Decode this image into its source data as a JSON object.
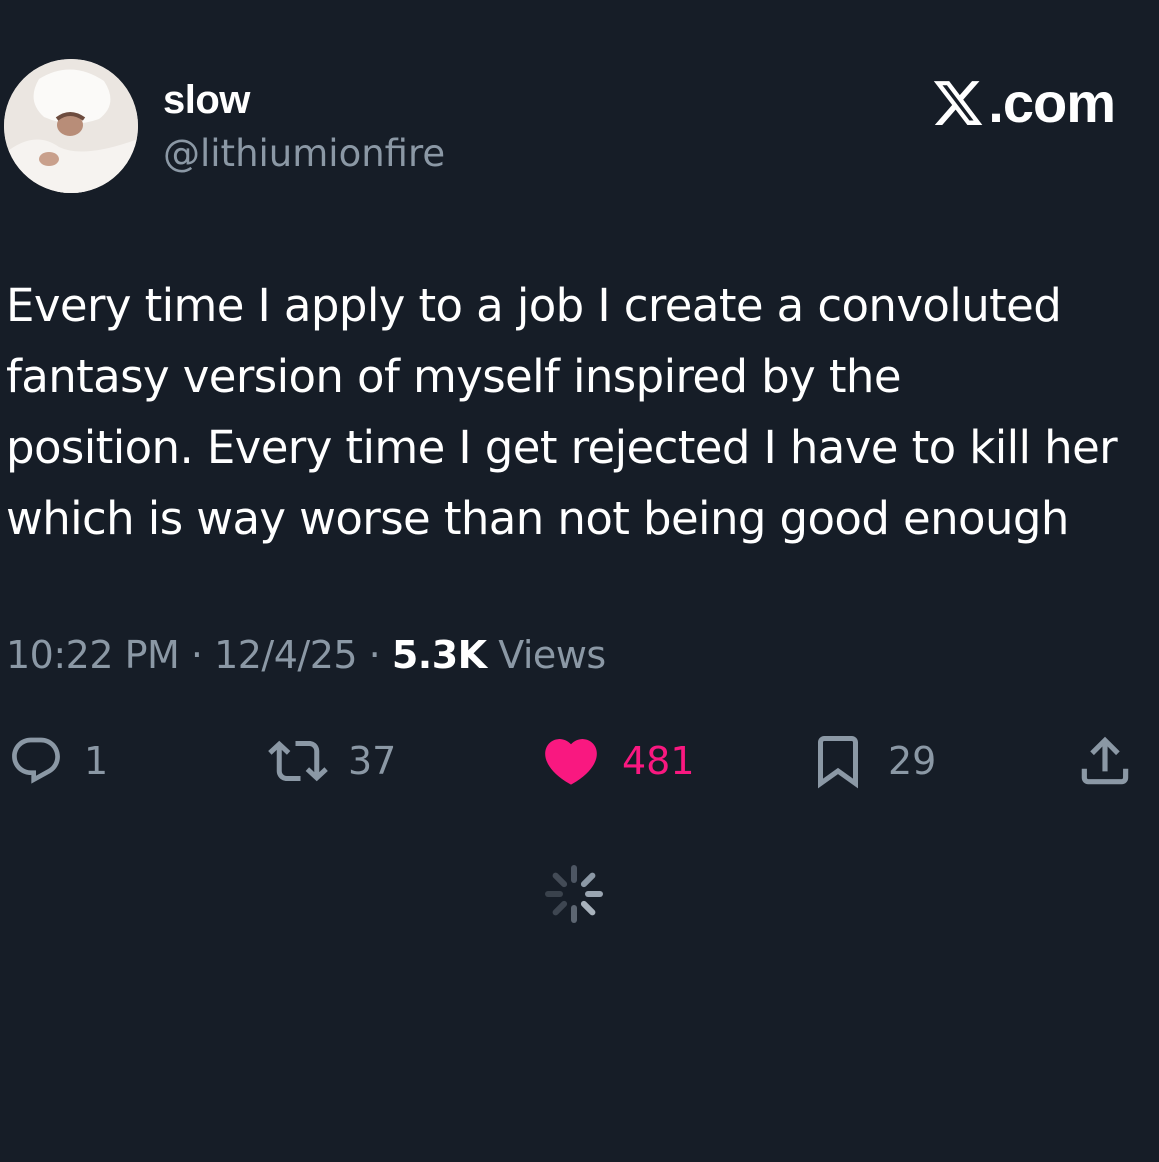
{
  "author": {
    "display_name": "slow",
    "handle": "@lithiumionfire"
  },
  "brand": {
    "label": ".com",
    "icon": "x-logo-icon"
  },
  "tweet": {
    "lines": [
      "Every time I apply to a job I create a convoluted",
      "fantasy version of myself inspired by the",
      "position. Every time I get rejected I have to kill her",
      "which is way worse than not being good enough"
    ]
  },
  "meta": {
    "time": "10:22 PM",
    "separator": "·",
    "date": "12/4/25",
    "views_count": "5.3K",
    "views_label": "Views"
  },
  "actions": {
    "reply": {
      "icon": "reply-icon",
      "count": "1"
    },
    "repost": {
      "icon": "repost-icon",
      "count": "37"
    },
    "like": {
      "icon": "heart-icon",
      "count": "481",
      "active": true
    },
    "bookmark": {
      "icon": "bookmark-icon",
      "count": "29"
    },
    "share": {
      "icon": "share-icon"
    }
  },
  "loading": {
    "icon": "loading-spinner-icon"
  },
  "colors": {
    "background": "#161d27",
    "text": "#ffffff",
    "secondary": "#8b98a5",
    "like": "#f91880"
  }
}
